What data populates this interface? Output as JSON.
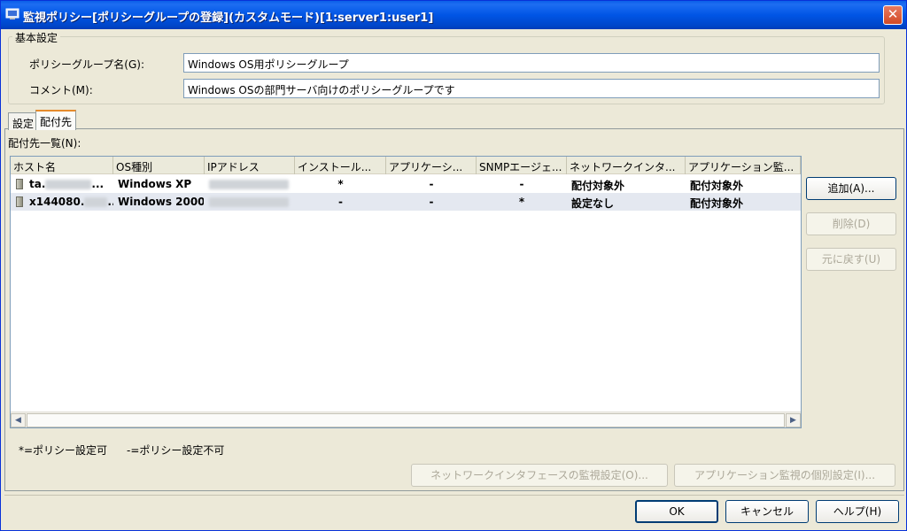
{
  "window": {
    "title": "監視ポリシー[ポリシーグループの登録](カスタムモード)[1:server1:user1]",
    "close_label": "✕"
  },
  "basic": {
    "legend": "基本設定",
    "group_name_label": "ポリシーグループ名(G):",
    "group_name_value": "Windows OS用ポリシーグループ",
    "comment_label": "コメント(M):",
    "comment_value": "Windows OSの部門サーバ向けのポリシーグループです"
  },
  "tabs": [
    {
      "label": "設定"
    },
    {
      "label": "配付先"
    }
  ],
  "list": {
    "label": "配付先一覧(N):",
    "columns": [
      "ホスト名",
      "OS種別",
      "IPアドレス",
      "インストール...",
      "アプリケーシ...",
      "SNMPエージェ...",
      "ネットワークインタ...",
      "アプリケーション監..."
    ],
    "rows": [
      {
        "host": "ta.",
        "host_suffix": "...",
        "os": "Windows XP",
        "install": "*",
        "app": "-",
        "snmp": "-",
        "net": "配付対象外",
        "appmon": "配付対象外"
      },
      {
        "host": "x144080.",
        "host_suffix": "...",
        "os": "Windows 2000",
        "install": "-",
        "app": "-",
        "snmp": "*",
        "net": "設定なし",
        "appmon": "配付対象外"
      }
    ]
  },
  "side_buttons": {
    "add": "追加(A)...",
    "delete": "削除(D)",
    "restore": "元に戻す(U)"
  },
  "legend_text": {
    "possible": "*=ポリシー設定可",
    "impossible": "-=ポリシー設定不可"
  },
  "detail_buttons": {
    "network": "ネットワークインタフェースの監視設定(O)...",
    "appmon": "アプリケーション監視の個別設定(I)..."
  },
  "footer": {
    "ok": "OK",
    "cancel": "キャンセル",
    "help": "ヘルプ(H)"
  },
  "icons": {
    "title": "policy-window-icon",
    "host": "server-icon"
  }
}
